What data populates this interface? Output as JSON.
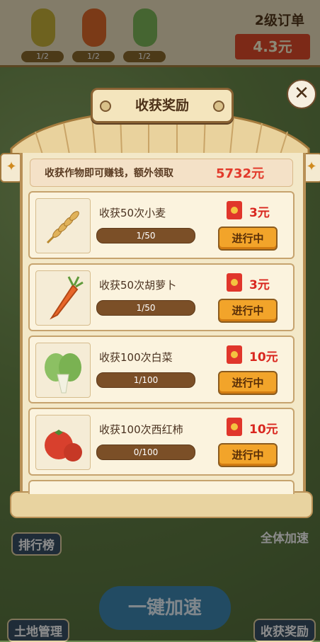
{
  "order_bar": {
    "title": "2级订单",
    "price": "4.3元",
    "crops": [
      {
        "icon": "corn-icon",
        "count": "1/2",
        "color": "#c9b23a"
      },
      {
        "icon": "carrot-icon",
        "count": "1/2",
        "color": "#e06b2a"
      },
      {
        "icon": "cabbage-icon",
        "count": "1/2",
        "color": "#7fb85a"
      }
    ]
  },
  "panel": {
    "title": "收获奖励",
    "banner_text": "收获作物即可赚钱，额外领取",
    "banner_amount": "5732元",
    "tasks": [
      {
        "name": "收获50次小麦",
        "progress": "1/50",
        "reward": "3元",
        "status": "进行中",
        "icon": "wheat-icon"
      },
      {
        "name": "收获50次胡萝卜",
        "progress": "1/50",
        "reward": "3元",
        "status": "进行中",
        "icon": "carrot-icon"
      },
      {
        "name": "收获100次白菜",
        "progress": "1/100",
        "reward": "10元",
        "status": "进行中",
        "icon": "bok-choy-icon"
      },
      {
        "name": "收获100次西红柿",
        "progress": "0/100",
        "reward": "10元",
        "status": "进行中",
        "icon": "tomato-icon"
      }
    ]
  },
  "background": {
    "rank_label": "排行榜",
    "speedup_all_label": "全体加速",
    "land_label": "土地管理",
    "one_key_label": "一键加速",
    "harvest_reward_label": "收获奖励"
  },
  "colors": {
    "accent_red": "#e23a2b",
    "button_orange": "#f2a42a",
    "bar_brown": "#7b4f27"
  }
}
